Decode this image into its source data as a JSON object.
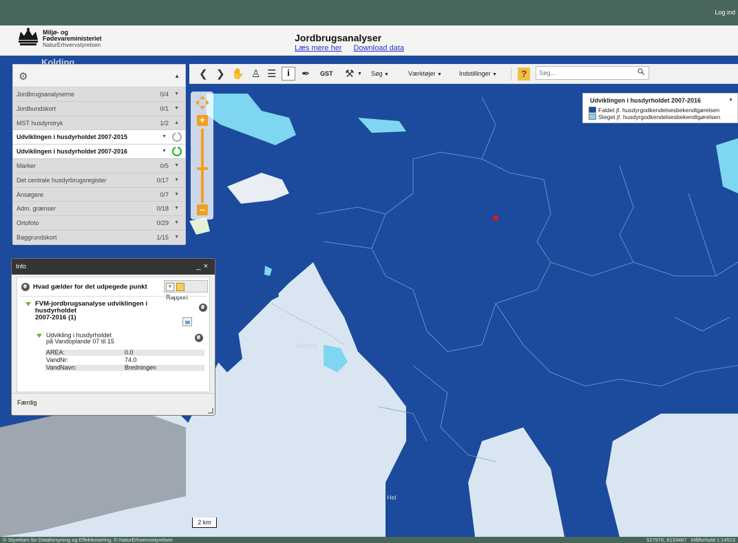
{
  "topbar": {
    "login": "Log ind"
  },
  "header": {
    "org_line1": "Miljø- og",
    "org_line2": "Fødevareministeriet",
    "org_line3": "NaturErhvervstyrelsen",
    "title": "Jordbrugsanalyser",
    "link_read_more": "Læs mere her",
    "link_download": "Download data"
  },
  "toolbar": {
    "gst_label": "GST",
    "search_menu": "Søg",
    "tools_menu": "Værktøjer",
    "settings_menu": "Indstillinger",
    "help_label": "?",
    "search_placeholder": "Søg..."
  },
  "layers": [
    {
      "label": "Jordbrugsanalyserne",
      "count": "0/4",
      "expanded": false
    },
    {
      "label": "Jordbundskort",
      "count": "0/1",
      "expanded": false
    },
    {
      "label": "MST husdyrstryk",
      "count": "1/2",
      "expanded": true
    },
    {
      "label": "Udviklingen i husdyrholdet 2007-2015",
      "count": "",
      "expanded": false,
      "active": true,
      "visible": false
    },
    {
      "label": "Udviklingen i husdyrholdet 2007-2016",
      "count": "",
      "expanded": false,
      "active": true,
      "visible": true
    },
    {
      "label": "Marker",
      "count": "0/5",
      "expanded": false
    },
    {
      "label": "Det centrale husdyrbrugsregister",
      "count": "0/17",
      "expanded": false
    },
    {
      "label": "Ansøgere",
      "count": "0/7",
      "expanded": false
    },
    {
      "label": "Adm. grænser",
      "count": "0/18",
      "expanded": false
    },
    {
      "label": "Ortofoto",
      "count": "0/29",
      "expanded": false
    },
    {
      "label": "Baggrundskort",
      "count": "1/15",
      "expanded": false
    }
  ],
  "legend": {
    "title": "Udviklingen i husdyrholdet 2007-2016",
    "items": [
      {
        "label": "Faldet jf. husdyrgodkendelsesbekendtgørelsen",
        "color": "#1c4a9c"
      },
      {
        "label": "Steget jf. husdyrgodkendelsesbekendtgørelsen",
        "color": "#7fd6f0"
      }
    ]
  },
  "info": {
    "window_title": "Info",
    "question": "Hvad gælder for det udpegede punkt",
    "report_button": "Rapport",
    "result_title_line1": "FVM-jordbrugsanalyse udviklingen i husdyrholdet",
    "result_title_line2": "2007-2016 (1)",
    "sub_line1": "Udvikling i husdyrholdet",
    "sub_line2": "på Vandoplande 07 til 15",
    "attributes": [
      {
        "key": "AREA:",
        "value": "0.0"
      },
      {
        "key": "VandNr:",
        "value": "74.0"
      },
      {
        "key": "VandNavn:",
        "value": "Bredningen"
      }
    ],
    "status": "Færdig"
  },
  "map": {
    "labels": {
      "assens": "Assens",
      "kolding": "Kolding",
      "helnaes": "Hel"
    },
    "scale_label": "2 km",
    "colors": {
      "decrease": "#1c4a9c",
      "increase": "#7fd6f0",
      "sea": "#d9e6f2"
    }
  },
  "statusbar": {
    "copyright": "© Styrelsen for Dataforsyning og Effektivisering, © NaturErhvervsstyrelsen",
    "coords": "527976, 6133487",
    "scale": "Målforhold 1:14513"
  }
}
